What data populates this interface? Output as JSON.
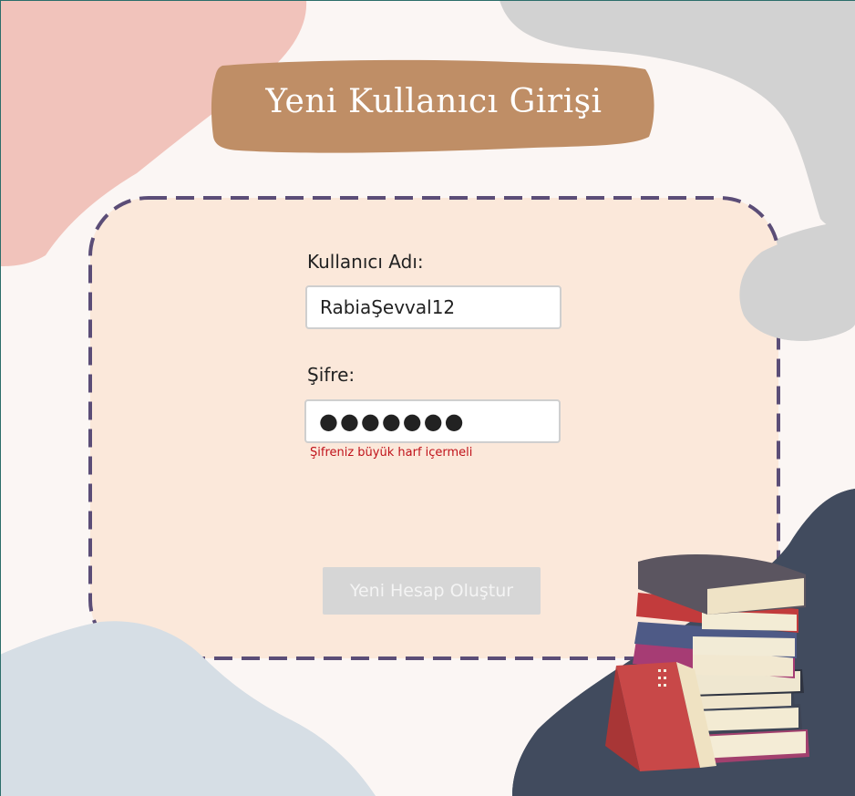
{
  "title": "Yeni Kullanıcı Girişi",
  "form": {
    "username": {
      "label": "Kullanıcı Adı:",
      "value": "RabiaŞevval12"
    },
    "password": {
      "label": "Şifre:",
      "value": "●●●●●●●",
      "error": "Şifreniz büyük harf içermeli"
    },
    "submit_label": "Yeni Hesap Oluştur"
  },
  "colors": {
    "background": "#fbf6f4",
    "blob_pink": "#f1c3bb",
    "blob_gray": "#d2d2d2",
    "blob_lightblue": "#d6dee5",
    "blob_navy": "#414b5e",
    "banner": "#bf8e66",
    "card_fill": "#fbe8da",
    "card_border": "#5b4d77",
    "error": "#c0121a",
    "button_disabled": "#d6d6d6"
  },
  "decorations": {
    "books_icon": "book-stack-illustration"
  }
}
